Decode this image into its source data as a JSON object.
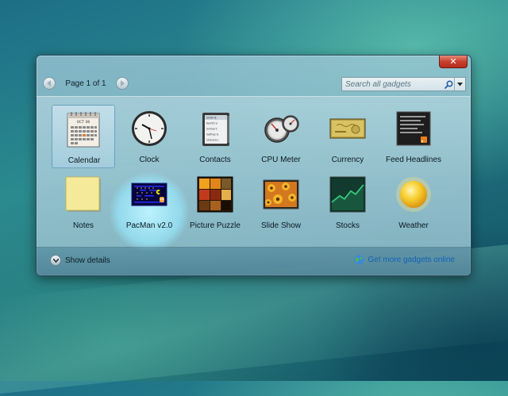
{
  "window": {
    "close_label": "✕"
  },
  "pager": {
    "text": "Page 1 of 1"
  },
  "search": {
    "placeholder": "Search all gadgets"
  },
  "gadgets": [
    {
      "label": "Calendar",
      "icon": "calendar-icon",
      "selected": true
    },
    {
      "label": "Clock",
      "icon": "clock-icon"
    },
    {
      "label": "Contacts",
      "icon": "contacts-icon"
    },
    {
      "label": "CPU Meter",
      "icon": "cpu-meter-icon"
    },
    {
      "label": "Currency",
      "icon": "currency-icon"
    },
    {
      "label": "Feed Headlines",
      "icon": "feed-headlines-icon"
    },
    {
      "label": "Notes",
      "icon": "notes-icon"
    },
    {
      "label": "PacMan v2.0",
      "icon": "pacman-icon",
      "hovered": true
    },
    {
      "label": "Picture Puzzle",
      "icon": "picture-puzzle-icon"
    },
    {
      "label": "Slide Show",
      "icon": "slide-show-icon"
    },
    {
      "label": "Stocks",
      "icon": "stocks-icon"
    },
    {
      "label": "Weather",
      "icon": "weather-icon"
    }
  ],
  "calendar_icon": {
    "month": "OCT 06"
  },
  "contacts_icon": {
    "entries": [
      "Smith B.",
      "Kerrith V.",
      "Grimal T.",
      "Geffrey A.",
      "Cheryne I."
    ]
  },
  "footer": {
    "details_label": "Show details",
    "more_label": "Get more gadgets online"
  },
  "colors": {
    "close": "#c8402e",
    "link": "#1560b8",
    "hover_glow": "#a6e6f5"
  }
}
